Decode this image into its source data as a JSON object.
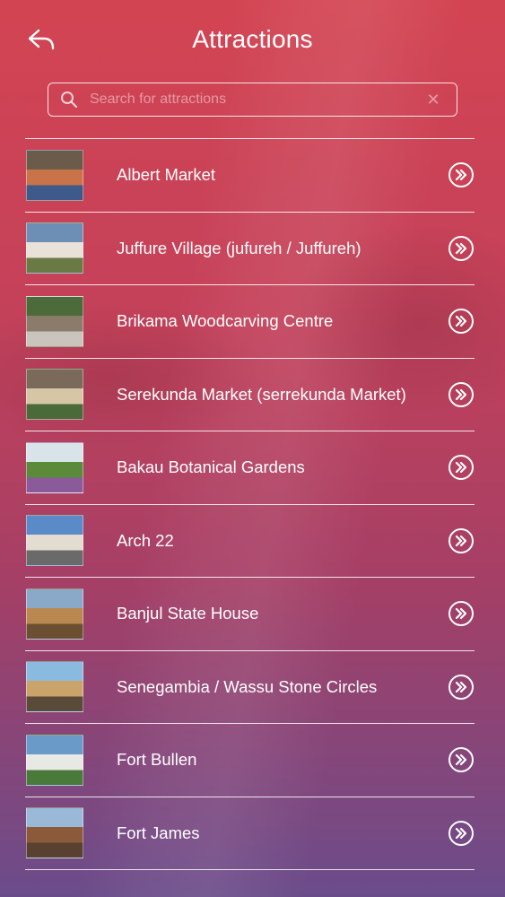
{
  "header": {
    "title": "Attractions",
    "back_icon": "back-arrow-icon"
  },
  "search": {
    "placeholder": "Search for attractions",
    "value": "",
    "icon": "search-icon",
    "clear_icon": "clear-icon"
  },
  "attractions": [
    {
      "name": "Albert Market",
      "thumb_colors": [
        "#6b5b4a",
        "#c8734a",
        "#3d5a8a"
      ]
    },
    {
      "name": "Juffure Village (jufureh / Juffureh)",
      "thumb_colors": [
        "#6e8fb5",
        "#e8e2d8",
        "#6a7a45"
      ]
    },
    {
      "name": "Brikama Woodcarving Centre",
      "thumb_colors": [
        "#4d6b3a",
        "#8a7b6a",
        "#c9c5bd"
      ]
    },
    {
      "name": "Serekunda Market (serrekunda Market)",
      "thumb_colors": [
        "#7a6a5a",
        "#d6c6a6",
        "#4a6a3a"
      ]
    },
    {
      "name": "Bakau Botanical Gardens",
      "thumb_colors": [
        "#d9e4ea",
        "#5a8a3a",
        "#8a5a9a"
      ]
    },
    {
      "name": "Arch 22",
      "thumb_colors": [
        "#5a8ac8",
        "#e2ddd0",
        "#6a6a6a"
      ]
    },
    {
      "name": "Banjul State House",
      "thumb_colors": [
        "#8aa8c8",
        "#b98850",
        "#6a5030"
      ]
    },
    {
      "name": "Senegambia / Wassu Stone Circles",
      "thumb_colors": [
        "#8abadf",
        "#c9a36a",
        "#5a4a3a"
      ]
    },
    {
      "name": "Fort Bullen",
      "thumb_colors": [
        "#6a9ac8",
        "#e8e8e4",
        "#4a7a3a"
      ]
    },
    {
      "name": "Fort James",
      "thumb_colors": [
        "#9ab8d8",
        "#8a5a3a",
        "#5a4030"
      ]
    }
  ],
  "row_action_icon": "double-chevron-right-icon"
}
